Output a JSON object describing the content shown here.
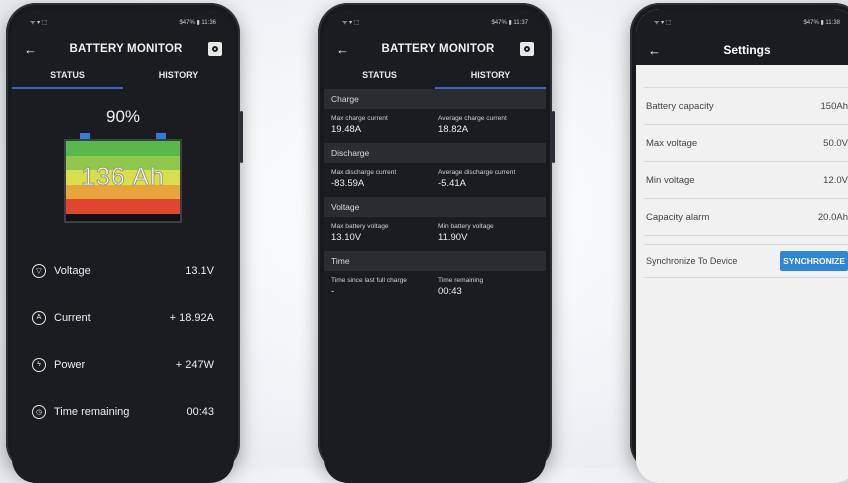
{
  "phones": [
    {
      "status_left": "ᯤ ▾ ⬚",
      "status_right": "$47% ▮ 11:36",
      "title": "BATTERY MONITOR",
      "tabs": [
        "STATUS",
        "HISTORY"
      ],
      "percent": "90%",
      "capacity_label": "136 Ah",
      "battery_fill_fraction": 0.9,
      "metrics": [
        {
          "icon": "voltage-icon",
          "label": "Voltage",
          "value": "13.1V"
        },
        {
          "icon": "current-icon",
          "label": "Current",
          "value": "+ 18.92A"
        },
        {
          "icon": "power-icon",
          "label": "Power",
          "value": "+ 247W"
        },
        {
          "icon": "clock-icon",
          "label": "Time remaining",
          "value": "00:43"
        }
      ]
    },
    {
      "status_left": "ᯤ ▾ ⬚",
      "status_right": "$47% ▮ 11:37",
      "title": "BATTERY MONITOR",
      "tabs": [
        "STATUS",
        "HISTORY"
      ],
      "sections": [
        {
          "header": "Charge",
          "cols": [
            {
              "label": "Max charge current",
              "value": "19.48A"
            },
            {
              "label": "Average charge current",
              "value": "18.82A"
            }
          ]
        },
        {
          "header": "Discharge",
          "cols": [
            {
              "label": "Max discharge current",
              "value": "-83.59A"
            },
            {
              "label": "Average discharge current",
              "value": "-5.41A"
            }
          ]
        },
        {
          "header": "Voltage",
          "cols": [
            {
              "label": "Max battery voltage",
              "value": "13.10V"
            },
            {
              "label": "Min battery voltage",
              "value": "11.90V"
            }
          ]
        },
        {
          "header": "Time",
          "cols": [
            {
              "label": "Time since last full charge",
              "value": "-"
            },
            {
              "label": "Time remaining",
              "value": "00:43"
            }
          ]
        }
      ]
    },
    {
      "status_left": "ᯤ ▾ ⬚",
      "status_right": "$47% ▮ 11:38",
      "title": "Settings",
      "rows": [
        {
          "label": "Battery capacity",
          "value": "150Ah"
        },
        {
          "label": "Max voltage",
          "value": "50.0V"
        },
        {
          "label": "Min voltage",
          "value": "12.0V"
        },
        {
          "label": "Capacity alarm",
          "value": "20.0Ah"
        }
      ],
      "sync_label": "Synchronize To Device",
      "sync_button": "SYNCHRONIZE"
    }
  ],
  "colors": {
    "tab_accent": "#3d63c9",
    "battery_bands": [
      "#59b84a",
      "#8fc84d",
      "#d8de4c",
      "#e8a53b",
      "#e0462f"
    ],
    "terminal": "#2f7de0",
    "sync_button": "#2f86d8"
  }
}
